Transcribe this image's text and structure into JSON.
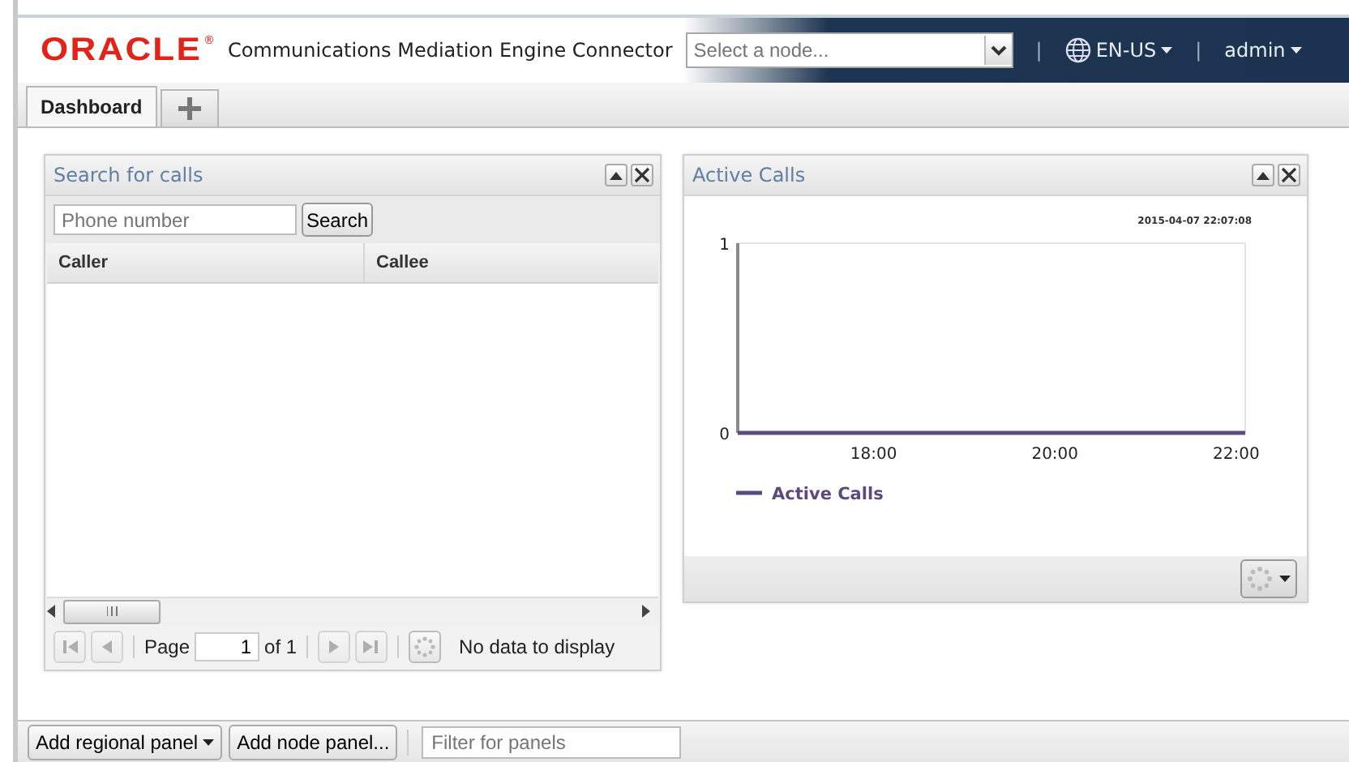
{
  "header": {
    "logo": "ORACLE",
    "logo_mark": "®",
    "app_title": "Communications Mediation Engine Connector",
    "node_select": {
      "placeholder": "Select a node..."
    },
    "separators": [
      "|",
      "|"
    ],
    "language": "EN-US",
    "user": "admin"
  },
  "tabs": [
    {
      "kind": "label",
      "label": "Dashboard",
      "selected": true
    },
    {
      "kind": "add",
      "selected": false
    }
  ],
  "search_panel": {
    "title": "Search for calls",
    "search_field": {
      "placeholder": "Phone number"
    },
    "search_button": "Search",
    "columns": [
      "Caller",
      "Callee"
    ],
    "pager": {
      "nav": [
        {
          "kind": "first",
          "disabled": true
        },
        {
          "kind": "prev",
          "disabled": true
        },
        {
          "kind": "next",
          "disabled": true
        },
        {
          "kind": "last",
          "disabled": true
        }
      ],
      "page_label": "Page",
      "page": "1",
      "of": "of 1",
      "status": "No data to display"
    }
  },
  "chart_panel": {
    "title": "Active Calls",
    "timestamp": "2015-04-07 22:07:08",
    "chart_data": {
      "type": "line",
      "x": [
        16.5,
        22.1
      ],
      "xlim": [
        16.5,
        22.1
      ],
      "ylim": [
        0,
        1
      ],
      "xticks": [
        {
          "value": 18,
          "label": "18:00"
        },
        {
          "value": 20,
          "label": "20:00"
        },
        {
          "value": 22,
          "label": "22:00"
        }
      ],
      "yticks": [
        0,
        1
      ],
      "series": [
        {
          "name": "Active Calls",
          "color": "#5b4a7e",
          "values": [
            0,
            0
          ]
        }
      ]
    }
  },
  "bottom_toolbar": {
    "regional_button": "Add regional panel",
    "node_button": "Add node panel...",
    "filter_field": {
      "placeholder": "Filter for panels"
    }
  }
}
